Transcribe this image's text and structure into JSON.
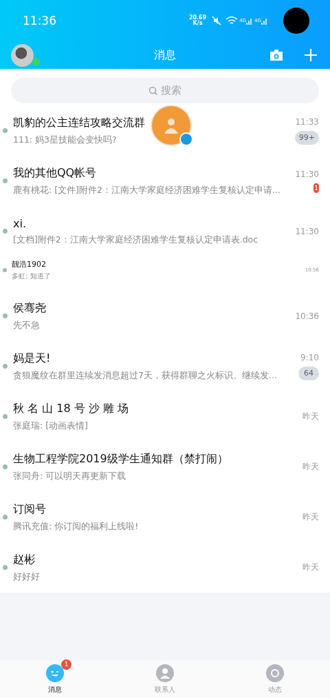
{
  "status_bar": {
    "time": "11:36",
    "net_speed": "20.69",
    "net_unit": "K/s",
    "network_labels": [
      "4G",
      "4G"
    ]
  },
  "header": {
    "title": "消息",
    "online": true
  },
  "search": {
    "placeholder": "搜索"
  },
  "conversations": [
    {
      "kind": "normal",
      "name": "凯豹的公主连结攻略交流群",
      "preview": "111: 妈3星技能会变快吗?",
      "time": "11:33",
      "badge": {
        "count": "99+",
        "muted": true
      }
    },
    {
      "kind": "normal",
      "name": "我的其他QQ帐号",
      "preview": "鹿有桃花: [文件]附件2：江南大学家庭经济困难学生复核认定申请...",
      "time": "11:30",
      "badge": {
        "count": "1",
        "muted": false
      }
    },
    {
      "kind": "normal",
      "name": "xi.",
      "preview": "[文档]附件2：江南大学家庭经济困难学生复核认定申请表.doc",
      "time": "11:30"
    },
    {
      "kind": "compact",
      "name": "靓浩1902",
      "preview": "多虹: 知道了",
      "time": "10:56"
    },
    {
      "kind": "normal",
      "name": "侯骞尧",
      "preview": "先不急",
      "time": "10:36"
    },
    {
      "kind": "normal",
      "name": "妈是天!",
      "preview": "贪狼魔纹在群里连续发消息超过7天，获得群聊之火标识。继续发...",
      "time": "9:10",
      "badge": {
        "count": "64",
        "muted": true
      }
    },
    {
      "kind": "normal",
      "name": "秋 名 山 18 号 沙 雕 场",
      "preview": "张庭瑞: [动画表情]",
      "time": "昨天"
    },
    {
      "kind": "normal",
      "name": "生物工程学院2019级学生通知群（禁打闹）",
      "preview": "张同舟: 可以明天再更新下载",
      "time": "昨天"
    },
    {
      "kind": "normal",
      "name": "订阅号",
      "preview": "腾讯充值: 你订阅的福利上线啦!",
      "time": "昨天"
    },
    {
      "kind": "normal",
      "name": "赵彬",
      "preview": "好好好",
      "time": "昨天"
    }
  ],
  "tab_bar": [
    {
      "label": "消息",
      "selected": true,
      "badge": "1"
    },
    {
      "label": "联系人",
      "selected": false
    },
    {
      "label": "动态",
      "selected": false
    }
  ]
}
